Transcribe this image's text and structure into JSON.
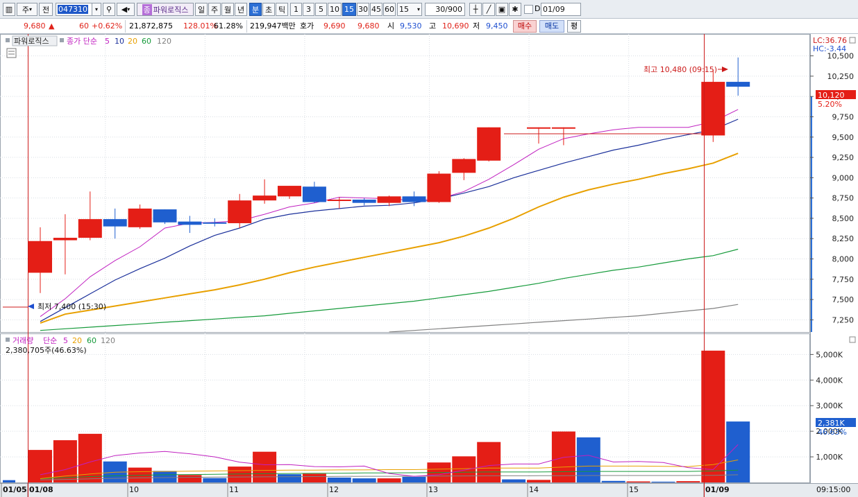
{
  "toolbar": {
    "menu_icon": "grid-menu-icon",
    "market_type": "주",
    "prev_label": "전",
    "code_value": "047310",
    "stock_name": "파워로직스",
    "stock_badge": "종",
    "period_day": "일",
    "period_week": "주",
    "period_month": "월",
    "period_year": "년",
    "period_minute": "분",
    "period_second": "초",
    "period_tick": "틱",
    "interval_1": "1",
    "interval_3": "3",
    "interval_5": "5",
    "interval_10": "10",
    "interval_15": "15",
    "interval_30": "30",
    "interval_45": "45",
    "interval_60": "60",
    "interval_select": "15",
    "count_display": "30/900",
    "date_prefix": "D",
    "date_value": "01/09"
  },
  "info": {
    "price": "9,680",
    "change_arrow": "▲",
    "change": "60",
    "change_rate": "+0.62%",
    "volume": "21,872,875",
    "volume_ratio": "128.01%",
    "turnover_ratio": "61.28%",
    "amount": "219,947백만",
    "quote_label": "호가",
    "ask": "9,690",
    "bid": "9,680",
    "open_label": "시",
    "open": "9,530",
    "high_label": "고",
    "high": "10,690",
    "low_label": "저",
    "low": "9,450",
    "buy_label": "매수",
    "sell_label": "매도",
    "eval_label": "평"
  },
  "price_panel": {
    "stock_tag": "파워로직스",
    "ma_label": "종가 단순",
    "ma_periods": [
      "5",
      "10",
      "20",
      "60",
      "120"
    ],
    "ma_colors": [
      "#c020c0",
      "#1a2f9a",
      "#e8a000",
      "#159a3a",
      "#808080"
    ],
    "lc_label": "LC:36.76",
    "hc_label": "HC:-3.44",
    "current_price_tag": "10,120",
    "current_rate_tag": "5.20%",
    "high_annotation": "최고 10,480 (09:15)",
    "low_annotation": "최저 7,400 (15:30)"
  },
  "volume_panel": {
    "title": "거래량",
    "ma_label": "단순",
    "ma_periods": [
      "5",
      "20",
      "60",
      "120"
    ],
    "ma_colors": [
      "#c020c0",
      "#e8a000",
      "#159a3a",
      "#808080"
    ],
    "last_volume": "2,380,705주(46.63%)",
    "volume_tag": "2,381K",
    "volume_rate_tag": "46.63%"
  },
  "x_axis": {
    "labels": [
      "01/05",
      "01/08",
      "10",
      "11",
      "12",
      "13",
      "14",
      "15",
      "01/09"
    ],
    "time_label": "09:15:00"
  },
  "colors": {
    "up": "#e41e16",
    "down": "#1f5fcf",
    "grid": "#d8dde3",
    "accent_red": "#cc1a1a"
  },
  "chart_data": [
    {
      "type": "candlestick",
      "ylim": [
        7100,
        10650
      ],
      "y_ticks": [
        "7,250",
        "7,500",
        "7,750",
        "8,000",
        "8,250",
        "8,500",
        "8,750",
        "9,000",
        "9,250",
        "9,500",
        "9,750",
        "10,000",
        "10,250",
        "10,500"
      ],
      "candles": [
        {
          "o": 7830,
          "h": 8390,
          "l": 7580,
          "c": 8220
        },
        {
          "o": 8230,
          "h": 8550,
          "l": 7810,
          "c": 8260
        },
        {
          "o": 8260,
          "h": 8830,
          "l": 8230,
          "c": 8490
        },
        {
          "o": 8490,
          "h": 8620,
          "l": 8250,
          "c": 8400
        },
        {
          "o": 8390,
          "h": 8670,
          "l": 8370,
          "c": 8620
        },
        {
          "o": 8610,
          "h": 8610,
          "l": 8430,
          "c": 8450
        },
        {
          "o": 8460,
          "h": 8530,
          "l": 8320,
          "c": 8420
        },
        {
          "o": 8450,
          "h": 8500,
          "l": 8400,
          "c": 8440
        },
        {
          "o": 8440,
          "h": 8800,
          "l": 8380,
          "c": 8720
        },
        {
          "o": 8720,
          "h": 8980,
          "l": 8680,
          "c": 8780
        },
        {
          "o": 8770,
          "h": 8900,
          "l": 8740,
          "c": 8900
        },
        {
          "o": 8890,
          "h": 8950,
          "l": 8690,
          "c": 8700
        },
        {
          "o": 8720,
          "h": 8760,
          "l": 8620,
          "c": 8730
        },
        {
          "o": 8730,
          "h": 8750,
          "l": 8660,
          "c": 8690
        },
        {
          "o": 8690,
          "h": 8780,
          "l": 8650,
          "c": 8770
        },
        {
          "o": 8770,
          "h": 8830,
          "l": 8650,
          "c": 8700
        },
        {
          "o": 8700,
          "h": 9080,
          "l": 8690,
          "c": 9050
        },
        {
          "o": 9060,
          "h": 9240,
          "l": 8970,
          "c": 9230
        },
        {
          "o": 9210,
          "h": 9620,
          "l": 9200,
          "c": 9620
        },
        {
          "o": 9620,
          "h": 9620,
          "l": 9620,
          "c": 9620
        },
        {
          "o": 9620,
          "h": 9620,
          "l": 9420,
          "c": 9620
        },
        {
          "o": 9620,
          "h": 9620,
          "l": 9400,
          "c": 9620
        },
        {
          "o": 9620,
          "h": 9620,
          "l": 9620,
          "c": 9620
        },
        {
          "o": 9620,
          "h": 9620,
          "l": 9620,
          "c": 9620
        },
        {
          "o": 9620,
          "h": 9620,
          "l": 9620,
          "c": 9620
        },
        {
          "o": 9620,
          "h": 9620,
          "l": 9620,
          "c": 9620
        },
        {
          "o": 9620,
          "h": 9620,
          "l": 9620,
          "c": 9620
        },
        {
          "o": 9520,
          "h": 10330,
          "l": 9440,
          "c": 10180
        },
        {
          "o": 10180,
          "h": 10480,
          "l": 10010,
          "c": 10120
        }
      ],
      "ma": {
        "ma5": [
          7290,
          7510,
          7780,
          7980,
          8150,
          8380,
          8440,
          8450,
          8470,
          8550,
          8640,
          8690,
          8760,
          8750,
          8740,
          8720,
          8740,
          8830,
          8980,
          9160,
          9350,
          9480,
          9540,
          9590,
          9620,
          9620,
          9620,
          9690,
          9840
        ],
        "ma10": [
          7230,
          7400,
          7570,
          7740,
          7880,
          8010,
          8160,
          8290,
          8380,
          8490,
          8550,
          8590,
          8620,
          8650,
          8660,
          8690,
          8740,
          8810,
          8890,
          9000,
          9090,
          9180,
          9260,
          9340,
          9400,
          9470,
          9530,
          9590,
          9720
        ],
        "ma20": [
          7210,
          7320,
          7370,
          7420,
          7470,
          7520,
          7570,
          7620,
          7680,
          7750,
          7830,
          7900,
          7960,
          8020,
          8080,
          8140,
          8200,
          8280,
          8380,
          8500,
          8640,
          8760,
          8850,
          8920,
          8980,
          9050,
          9110,
          9180,
          9300
        ],
        "ma60": [
          7120,
          7140,
          7160,
          7180,
          7200,
          7220,
          7240,
          7260,
          7280,
          7300,
          7330,
          7360,
          7390,
          7420,
          7450,
          7480,
          7520,
          7560,
          7600,
          7650,
          7700,
          7760,
          7810,
          7860,
          7900,
          7950,
          8000,
          8040,
          8120
        ],
        "ma120": [
          null,
          null,
          null,
          null,
          null,
          null,
          null,
          null,
          null,
          null,
          null,
          null,
          null,
          null,
          7100,
          7120,
          7140,
          7160,
          7180,
          7200,
          7220,
          7240,
          7260,
          7280,
          7300,
          7330,
          7360,
          7390,
          7440
        ]
      }
    },
    {
      "type": "bar",
      "ylabel": "거래량",
      "ylim": [
        0,
        5200
      ],
      "y_ticks": [
        "1,000K",
        "2,000K",
        "3,000K",
        "4,000K",
        "5,000K"
      ],
      "values": [
        1270,
        1650,
        1900,
        820,
        580,
        450,
        290,
        170,
        620,
        1200,
        320,
        340,
        190,
        160,
        160,
        220,
        780,
        1020,
        1580,
        120,
        100,
        1990,
        1760,
        60,
        40,
        30,
        50,
        5150,
        2381
      ],
      "up": [
        true,
        true,
        true,
        false,
        true,
        false,
        true,
        false,
        true,
        true,
        false,
        true,
        false,
        false,
        true,
        false,
        true,
        true,
        true,
        false,
        true,
        true,
        false,
        false,
        true,
        false,
        true,
        true,
        false
      ],
      "ma5": [
        300,
        500,
        800,
        1050,
        1150,
        1210,
        1120,
        1000,
        790,
        690,
        700,
        620,
        610,
        640,
        350,
        240,
        300,
        480,
        660,
        720,
        720,
        980,
        1060,
        800,
        820,
        780,
        580,
        500,
        1480
      ],
      "ma20": [
        150,
        250,
        330,
        400,
        420,
        430,
        440,
        450,
        460,
        470,
        480,
        480,
        490,
        490,
        500,
        500,
        520,
        540,
        560,
        560,
        560,
        600,
        640,
        640,
        640,
        630,
        620,
        700,
        880
      ],
      "ma60": [
        140,
        190,
        230,
        260,
        280,
        300,
        310,
        320,
        330,
        340,
        350,
        360,
        360,
        370,
        370,
        380,
        390,
        400,
        410,
        410,
        410,
        420,
        430,
        430,
        430,
        430,
        430,
        450,
        480
      ],
      "ma120": [
        100,
        120,
        140,
        160,
        180,
        190,
        200,
        210,
        215,
        220,
        225,
        230,
        235,
        240,
        240,
        245,
        250,
        255,
        260,
        260,
        262,
        265,
        270,
        270,
        270,
        270,
        270,
        280,
        300
      ]
    }
  ]
}
